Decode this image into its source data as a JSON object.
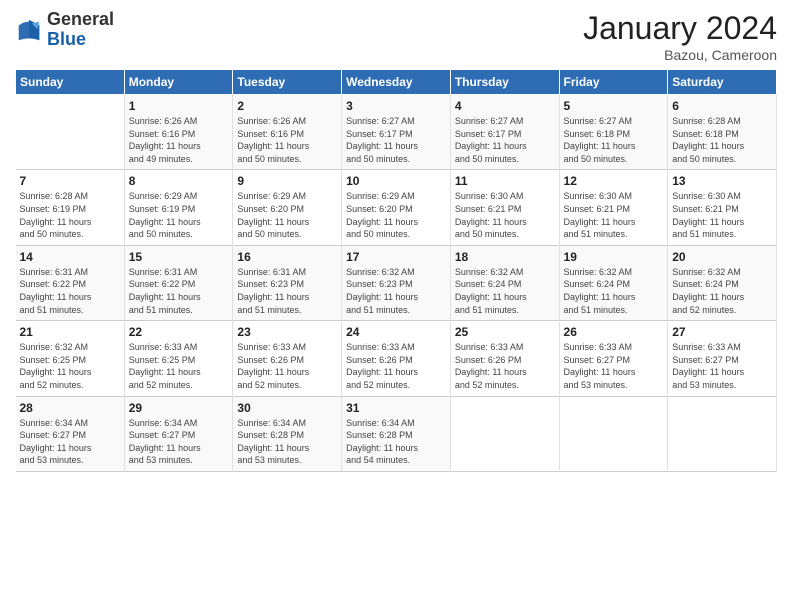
{
  "logo": {
    "general": "General",
    "blue": "Blue"
  },
  "title": "January 2024",
  "subtitle": "Bazou, Cameroon",
  "header_days": [
    "Sunday",
    "Monday",
    "Tuesday",
    "Wednesday",
    "Thursday",
    "Friday",
    "Saturday"
  ],
  "weeks": [
    [
      {
        "day": "",
        "info": ""
      },
      {
        "day": "1",
        "info": "Sunrise: 6:26 AM\nSunset: 6:16 PM\nDaylight: 11 hours\nand 49 minutes."
      },
      {
        "day": "2",
        "info": "Sunrise: 6:26 AM\nSunset: 6:16 PM\nDaylight: 11 hours\nand 50 minutes."
      },
      {
        "day": "3",
        "info": "Sunrise: 6:27 AM\nSunset: 6:17 PM\nDaylight: 11 hours\nand 50 minutes."
      },
      {
        "day": "4",
        "info": "Sunrise: 6:27 AM\nSunset: 6:17 PM\nDaylight: 11 hours\nand 50 minutes."
      },
      {
        "day": "5",
        "info": "Sunrise: 6:27 AM\nSunset: 6:18 PM\nDaylight: 11 hours\nand 50 minutes."
      },
      {
        "day": "6",
        "info": "Sunrise: 6:28 AM\nSunset: 6:18 PM\nDaylight: 11 hours\nand 50 minutes."
      }
    ],
    [
      {
        "day": "7",
        "info": "Sunrise: 6:28 AM\nSunset: 6:19 PM\nDaylight: 11 hours\nand 50 minutes."
      },
      {
        "day": "8",
        "info": "Sunrise: 6:29 AM\nSunset: 6:19 PM\nDaylight: 11 hours\nand 50 minutes."
      },
      {
        "day": "9",
        "info": "Sunrise: 6:29 AM\nSunset: 6:20 PM\nDaylight: 11 hours\nand 50 minutes."
      },
      {
        "day": "10",
        "info": "Sunrise: 6:29 AM\nSunset: 6:20 PM\nDaylight: 11 hours\nand 50 minutes."
      },
      {
        "day": "11",
        "info": "Sunrise: 6:30 AM\nSunset: 6:21 PM\nDaylight: 11 hours\nand 50 minutes."
      },
      {
        "day": "12",
        "info": "Sunrise: 6:30 AM\nSunset: 6:21 PM\nDaylight: 11 hours\nand 51 minutes."
      },
      {
        "day": "13",
        "info": "Sunrise: 6:30 AM\nSunset: 6:21 PM\nDaylight: 11 hours\nand 51 minutes."
      }
    ],
    [
      {
        "day": "14",
        "info": "Sunrise: 6:31 AM\nSunset: 6:22 PM\nDaylight: 11 hours\nand 51 minutes."
      },
      {
        "day": "15",
        "info": "Sunrise: 6:31 AM\nSunset: 6:22 PM\nDaylight: 11 hours\nand 51 minutes."
      },
      {
        "day": "16",
        "info": "Sunrise: 6:31 AM\nSunset: 6:23 PM\nDaylight: 11 hours\nand 51 minutes."
      },
      {
        "day": "17",
        "info": "Sunrise: 6:32 AM\nSunset: 6:23 PM\nDaylight: 11 hours\nand 51 minutes."
      },
      {
        "day": "18",
        "info": "Sunrise: 6:32 AM\nSunset: 6:24 PM\nDaylight: 11 hours\nand 51 minutes."
      },
      {
        "day": "19",
        "info": "Sunrise: 6:32 AM\nSunset: 6:24 PM\nDaylight: 11 hours\nand 51 minutes."
      },
      {
        "day": "20",
        "info": "Sunrise: 6:32 AM\nSunset: 6:24 PM\nDaylight: 11 hours\nand 52 minutes."
      }
    ],
    [
      {
        "day": "21",
        "info": "Sunrise: 6:32 AM\nSunset: 6:25 PM\nDaylight: 11 hours\nand 52 minutes."
      },
      {
        "day": "22",
        "info": "Sunrise: 6:33 AM\nSunset: 6:25 PM\nDaylight: 11 hours\nand 52 minutes."
      },
      {
        "day": "23",
        "info": "Sunrise: 6:33 AM\nSunset: 6:26 PM\nDaylight: 11 hours\nand 52 minutes."
      },
      {
        "day": "24",
        "info": "Sunrise: 6:33 AM\nSunset: 6:26 PM\nDaylight: 11 hours\nand 52 minutes."
      },
      {
        "day": "25",
        "info": "Sunrise: 6:33 AM\nSunset: 6:26 PM\nDaylight: 11 hours\nand 52 minutes."
      },
      {
        "day": "26",
        "info": "Sunrise: 6:33 AM\nSunset: 6:27 PM\nDaylight: 11 hours\nand 53 minutes."
      },
      {
        "day": "27",
        "info": "Sunrise: 6:33 AM\nSunset: 6:27 PM\nDaylight: 11 hours\nand 53 minutes."
      }
    ],
    [
      {
        "day": "28",
        "info": "Sunrise: 6:34 AM\nSunset: 6:27 PM\nDaylight: 11 hours\nand 53 minutes."
      },
      {
        "day": "29",
        "info": "Sunrise: 6:34 AM\nSunset: 6:27 PM\nDaylight: 11 hours\nand 53 minutes."
      },
      {
        "day": "30",
        "info": "Sunrise: 6:34 AM\nSunset: 6:28 PM\nDaylight: 11 hours\nand 53 minutes."
      },
      {
        "day": "31",
        "info": "Sunrise: 6:34 AM\nSunset: 6:28 PM\nDaylight: 11 hours\nand 54 minutes."
      },
      {
        "day": "",
        "info": ""
      },
      {
        "day": "",
        "info": ""
      },
      {
        "day": "",
        "info": ""
      }
    ]
  ]
}
